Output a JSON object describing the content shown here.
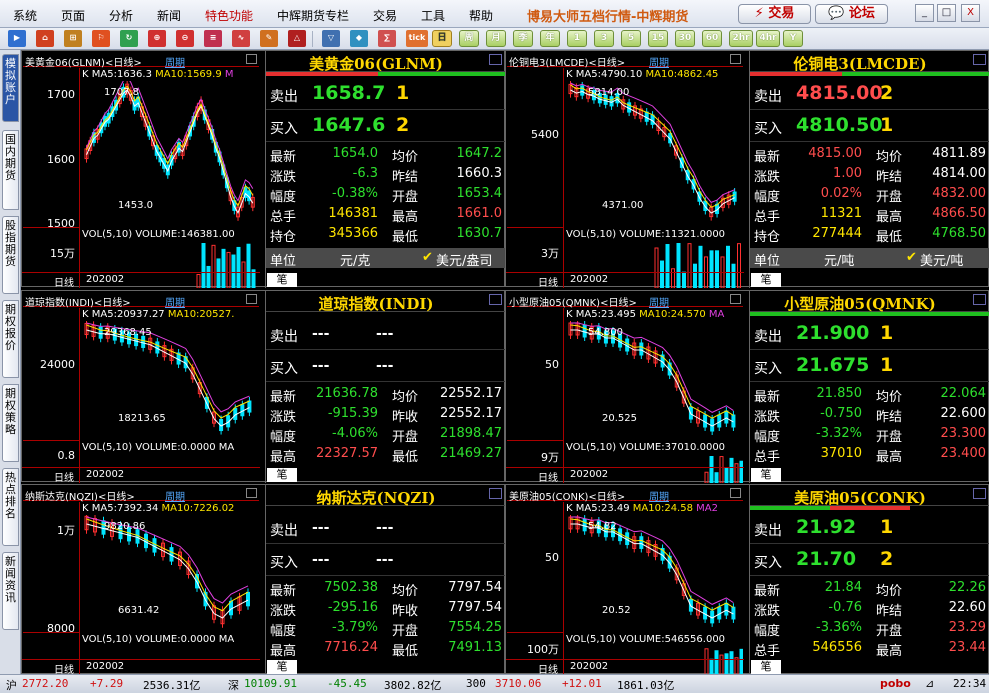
{
  "menu": [
    "系统",
    "页面",
    "分析",
    "新闻",
    "特色功能",
    "中辉期货专栏",
    "交易",
    "工具",
    "帮助"
  ],
  "app_title": "博易大师五档行情-中辉期货",
  "trade_btn": "交易",
  "forum_btn": "论坛",
  "win": [
    "_",
    "□",
    "X"
  ],
  "periods": [
    "日",
    "周",
    "月",
    "季",
    "年",
    "1",
    "3",
    "5",
    "15",
    "30",
    "60",
    "2hr",
    "4hr",
    "Y"
  ],
  "tb_labels": [
    "▶",
    "⌂",
    "⊞",
    "⚐",
    "↻",
    "⊕",
    "⊖",
    "≡",
    "∿",
    "✎",
    "△",
    "▽",
    "◆",
    "∑",
    "tick"
  ],
  "sidetabs": [
    "模拟账户",
    "国内期货",
    "股指期货",
    "期权报价",
    "期权策略",
    "热点排名",
    "新闻资讯"
  ],
  "panels": [
    {
      "name": "美黄金06(GLNM)<日线>",
      "period": "周期",
      "ma5": "MA5:1636.3",
      "ma10": "MA10:1569.9",
      "ma_extra": "M",
      "y": [
        "1700",
        "1600",
        "1500"
      ],
      "hi": "1707.8",
      "lo": "1453.0",
      "vol_text": "VOL(5,10) VOLUME:146381.00",
      "vol_y": "15万",
      "dl": "日线",
      "date": "202002",
      "title": "美黄金06(GLNM)",
      "sell_lbl": "卖出",
      "sell": "1658.7",
      "sell_v": "1",
      "buy_lbl": "买入",
      "buy": "1647.6",
      "buy_v": "2",
      "rows": [
        [
          "最新",
          "1654.0",
          "均价",
          "1647.2"
        ],
        [
          "涨跌",
          "-6.3",
          "昨结",
          "1660.3"
        ],
        [
          "幅度",
          "-0.38%",
          "开盘",
          "1653.4"
        ],
        [
          "总手",
          "146381",
          "最高",
          "1661.0"
        ],
        [
          "持仓",
          "345366",
          "最低",
          "1630.7"
        ]
      ],
      "unit_lbl": "单位",
      "unit": "元/克",
      "unit2": "美元/盎司",
      "bi": "笔"
    },
    {
      "name": "伦铜电3(LMCDE)<日线>",
      "period": "周期",
      "ma5": "MA5:4790.10",
      "ma10": "MA10:4862.45",
      "ma_extra": "",
      "y": [
        "5400"
      ],
      "hi": "5814.00",
      "lo": "4371.00",
      "vol_text": "VOL(5,10) VOLUME:11321.0000",
      "vol_y": "3万",
      "dl": "日线",
      "date": "202002",
      "title": "伦铜电3(LMCDE)",
      "sell_lbl": "卖出",
      "sell": "4815.00",
      "sell_v": "2",
      "buy_lbl": "买入",
      "buy": "4810.50",
      "buy_v": "1",
      "rows": [
        [
          "最新",
          "4815.00",
          "均价",
          "4811.89"
        ],
        [
          "涨跌",
          "1.00",
          "昨结",
          "4814.00"
        ],
        [
          "幅度",
          "0.02%",
          "开盘",
          "4832.00"
        ],
        [
          "总手",
          "11321",
          "最高",
          "4866.50"
        ],
        [
          "持仓",
          "277444",
          "最低",
          "4768.50"
        ]
      ],
      "unit_lbl": "单位",
      "unit": "元/吨",
      "unit2": "美元/吨",
      "bi": "笔"
    },
    {
      "name": "道琼指数(INDI)<日线>",
      "period": "周期",
      "ma5": "MA5:20937.27",
      "ma10": "MA10:20527.",
      "ma_extra": "",
      "y": [
        "24000"
      ],
      "hi": "29368.45",
      "lo": "18213.65",
      "vol_text": "VOL(5,10) VOLUME:0.0000 MA",
      "vol_y": "0.8",
      "dl": "日线",
      "date": "202002",
      "title": "道琼指数(INDI)",
      "sell_lbl": "卖出",
      "sell": "---",
      "sell_v": "---",
      "buy_lbl": "买入",
      "buy": "---",
      "buy_v": "---",
      "rows": [
        [
          "最新",
          "21636.78",
          "均价",
          "22552.17"
        ],
        [
          "涨跌",
          "-915.39",
          "昨收",
          "22552.17"
        ],
        [
          "幅度",
          "-4.06%",
          "开盘",
          "21898.47"
        ],
        [
          "最高",
          "22327.57",
          "最低",
          "21469.27"
        ]
      ],
      "bi": "笔"
    },
    {
      "name": "小型原油05(QMNK)<日线>",
      "period": "周期",
      "ma5": "MA5:23.495",
      "ma10": "MA10:24.570",
      "ma_extra": "MA",
      "y": [
        "50"
      ],
      "hi": "54.800",
      "lo": "20.525",
      "vol_text": "VOL(5,10) VOLUME:37010.0000",
      "vol_y": "9万",
      "dl": "日线",
      "date": "202002",
      "title": "小型原油05(QMNK)",
      "sell_lbl": "卖出",
      "sell": "21.900",
      "sell_v": "1",
      "buy_lbl": "买入",
      "buy": "21.675",
      "buy_v": "1",
      "rows": [
        [
          "最新",
          "21.850",
          "均价",
          "22.064"
        ],
        [
          "涨跌",
          "-0.750",
          "昨结",
          "22.600"
        ],
        [
          "幅度",
          "-3.32%",
          "开盘",
          "23.300"
        ],
        [
          "总手",
          "37010",
          "最高",
          "23.400"
        ]
      ],
      "bi": "笔"
    },
    {
      "name": "纳斯达克(NQZI)<日线>",
      "period": "周期",
      "ma5": "MA5:7392.34",
      "ma10": "MA10:7226.02",
      "ma_extra": "",
      "y": [
        "1万",
        "8000"
      ],
      "hi": "9820.86",
      "lo": "6631.42",
      "vol_text": "VOL(5,10) VOLUME:0.0000 MA",
      "vol_y": "",
      "dl": "日线",
      "date": "202002",
      "title": "纳斯达克(NQZI)",
      "sell_lbl": "卖出",
      "sell": "---",
      "sell_v": "---",
      "buy_lbl": "买入",
      "buy": "---",
      "buy_v": "---",
      "rows": [
        [
          "最新",
          "7502.38",
          "均价",
          "7797.54"
        ],
        [
          "涨跌",
          "-295.16",
          "昨收",
          "7797.54"
        ],
        [
          "幅度",
          "-3.79%",
          "开盘",
          "7554.25"
        ],
        [
          "最高",
          "7716.24",
          "最低",
          "7491.13"
        ]
      ],
      "bi": "笔"
    },
    {
      "name": "美原油05(CONK)<日线>",
      "period": "周期",
      "ma5": "MA5:23.49",
      "ma10": "MA10:24.58",
      "ma_extra": "MA2",
      "y": [
        "50"
      ],
      "hi": "54.82",
      "lo": "20.52",
      "vol_text": "VOL(5,10) VOLUME:546556.000",
      "vol_y": "100万",
      "dl": "日线",
      "date": "202002",
      "title": "美原油05(CONK)",
      "sell_lbl": "卖出",
      "sell": "21.92",
      "sell_v": "1",
      "buy_lbl": "买入",
      "buy": "21.70",
      "buy_v": "2",
      "rows": [
        [
          "最新",
          "21.84",
          "均价",
          "22.26"
        ],
        [
          "涨跌",
          "-0.76",
          "昨结",
          "22.60"
        ],
        [
          "幅度",
          "-3.36%",
          "开盘",
          "23.29"
        ],
        [
          "总手",
          "546556",
          "最高",
          "23.44"
        ]
      ],
      "bi": "笔"
    }
  ],
  "status": {
    "hu": "沪",
    "hu_v": "2772.20",
    "hu_c": "+7.29",
    "hu_a": "2536.31亿",
    "shen": "深",
    "shen_v": "10109.91",
    "shen_c": "-45.45",
    "shen_a": "3802.82亿",
    "i300": "300",
    "i300_v": "3710.06",
    "i300_c": "+12.01",
    "i300_a": "1861.03亿",
    "brand": "pobo",
    "time": "22:34"
  }
}
